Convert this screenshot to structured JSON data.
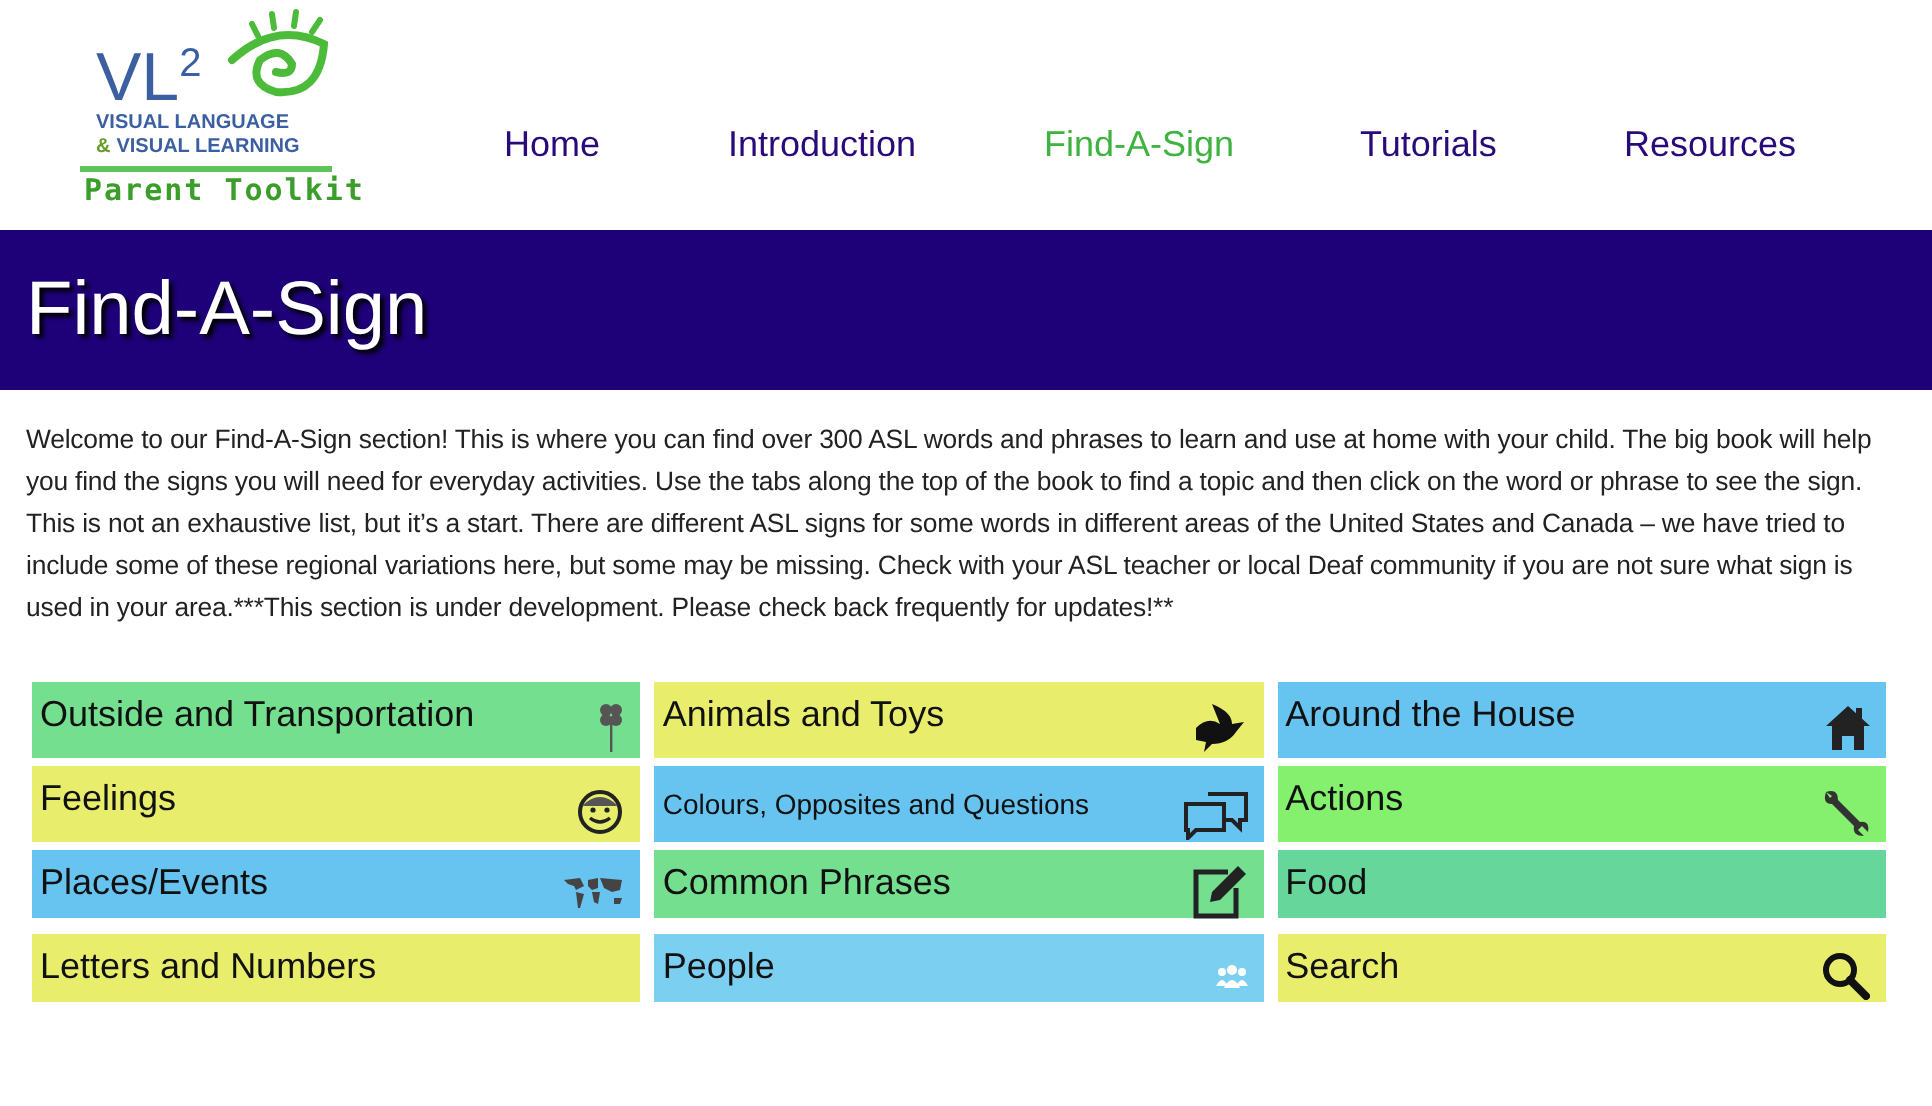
{
  "logo": {
    "mark": "VL",
    "superscript": "2",
    "line_1": "VISUAL LANGUAGE",
    "line_2_amp": "&",
    "line_2": "VISUAL LEARNING",
    "tagline": "Parent Toolkit"
  },
  "nav": [
    {
      "label": "Home",
      "selected": false
    },
    {
      "label": "Introduction",
      "selected": false
    },
    {
      "label": "Find-A-Sign",
      "selected": true
    },
    {
      "label": "Tutorials",
      "selected": false
    },
    {
      "label": "Resources",
      "selected": false
    }
  ],
  "banner": {
    "title": "Find-A-Sign"
  },
  "intro": "Welcome to our Find-A-Sign section! This is where you can find over 300 ASL words and phrases to learn and use at home with your child. The big book will help you find the signs you will need for everyday activities. Use the tabs along the top of the book to find a topic and then click on the word or phrase to see the sign. This is not an exhaustive list, but it’s a start. There are different ASL signs for some words in different areas of the United States and Canada – we have tried to include some of these regional variations here, but some may be missing. Check with your ASL teacher or local Deaf community if you are not sure what sign is used in your area.***This section is under development. Please check back frequently for updates!**",
  "columns": [
    {
      "tiles": [
        {
          "label": "Outside and Transportation",
          "color": "#74e08f"
        },
        {
          "label": "Feelings",
          "color": "#e8ee6c"
        },
        {
          "label": "Places/Events",
          "color": "#67c3ef"
        },
        {
          "label": "Letters and Numbers",
          "color": "#e8ee6c"
        }
      ]
    },
    {
      "tiles": [
        {
          "label": "Animals and Toys",
          "color": "#e8ee6c"
        },
        {
          "label": "Colours, Opposites and Questions",
          "color": "#67c3ef"
        },
        {
          "label": "Common Phrases",
          "color": "#74e08f"
        },
        {
          "label": "People",
          "color": "#7bcff0"
        }
      ]
    },
    {
      "tiles": [
        {
          "label": "Around the House",
          "color": "#67c3ef"
        },
        {
          "label": "Actions",
          "color": "#84f06e"
        },
        {
          "label": "Food",
          "color": "#66d69b"
        },
        {
          "label": "Search",
          "color": "#e8ee6c"
        }
      ]
    }
  ]
}
